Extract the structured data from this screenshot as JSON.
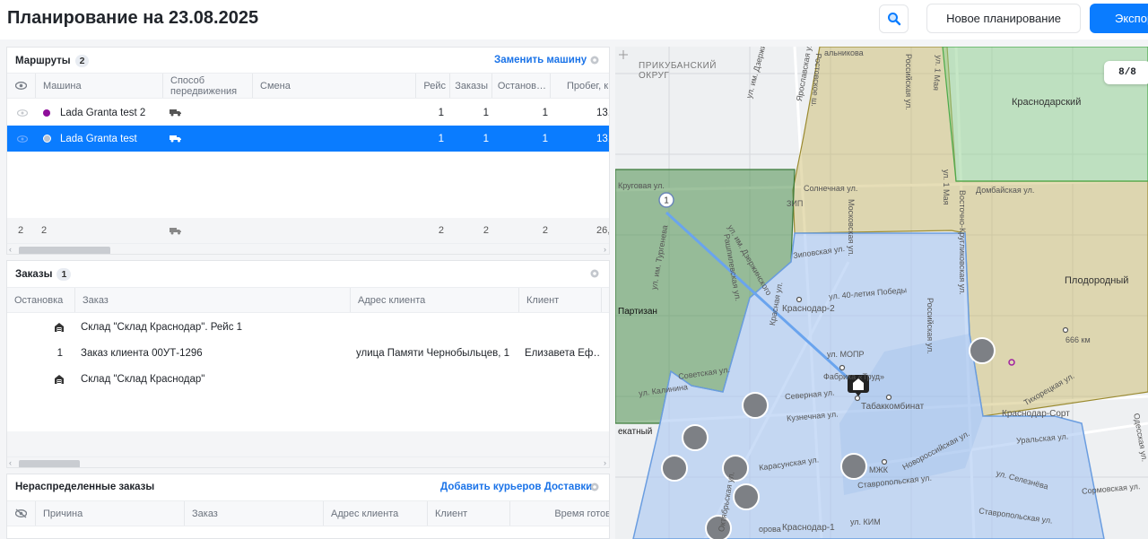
{
  "header": {
    "title": "Планирование на 23.08.2025",
    "new_planning_label": "Новое планирование",
    "export_label": "Экспор"
  },
  "routes": {
    "title": "Маршруты",
    "count": "2",
    "replace_car_label": "Заменить машину",
    "columns": [
      "Машина",
      "Способ передвижения",
      "Смена",
      "Рейс",
      "Заказы",
      "Останов…",
      "Пробег, к"
    ],
    "rows": [
      {
        "car": "Lada Granta test 2",
        "dot_color": "#8e0e9a",
        "trip": "1",
        "orders": "1",
        "stops": "1",
        "mileage": "13,",
        "selected": false
      },
      {
        "car": "Lada Granta test",
        "dot_color": "#b8c2d0",
        "trip": "1",
        "orders": "1",
        "stops": "1",
        "mileage": "13,",
        "selected": true
      }
    ],
    "totals": {
      "c1": "2",
      "c2": "2",
      "trip": "2",
      "orders": "2",
      "stops": "2",
      "mileage": "26,"
    }
  },
  "orders": {
    "title": "Заказы",
    "count": "1",
    "columns": [
      "Остановка",
      "Заказ",
      "Адрес клиента",
      "Клиент"
    ],
    "rows": [
      {
        "stop": "",
        "stop_icon": "warehouse-icon",
        "order": "Склад \"Склад Краснодар\". Рейс 1",
        "address": "",
        "client": ""
      },
      {
        "stop": "1",
        "stop_icon": "",
        "order": "Заказ клиента 00УТ-1296",
        "address": "улица Памяти Чернобыльцев, 1",
        "client": "Елизавета Еф…"
      },
      {
        "stop": "",
        "stop_icon": "warehouse-icon",
        "order": "Склад \"Склад Краснодар\"",
        "address": "",
        "client": ""
      }
    ]
  },
  "unassigned": {
    "title": "Нераспределенные заказы",
    "add_couriers_label": "Добавить курьеров Доставки",
    "columns": [
      "Причина",
      "Заказ",
      "Адрес клиента",
      "Клиент",
      "Время готов"
    ]
  },
  "map": {
    "route_counter": "8/8",
    "labels": {
      "prikubansky": "ПРИКУБАНСКИЙ\nОКРУГ",
      "krasnodarsky": "Краснодарский",
      "plodorodny": "Плодородный",
      "partizan": "Партизан",
      "krasnodar1": "Краснодар-1",
      "krasnodar2": "Краснодар-2",
      "krasnodar_sort": "Краснодар-Сорт",
      "tabakkombinat": "Табаккомбинат",
      "fabrika": "Фабрика «Труд»",
      "mzhk": "МЖК",
      "km666": "666 км",
      "zip": "ЗИП",
      "kalinina": "ул. Калинина",
      "sovetskaya": "Советская ул.",
      "severnaya": "Северная ул.",
      "severnaya2": "Северная ул.",
      "kuznechnaya": "Кузнечная ул.",
      "karasunskaya": "Карасунская ул.",
      "stavropolskaya": "Ставропольская ул.",
      "stavropolskaya2": "Ставропольская ул.",
      "uralskaya": "Уральская ул.",
      "selezneva": "ул. Селезнёва",
      "sormovskaya": "Сормовская ул.",
      "kim": "ул. КИМ",
      "novorossiyskaya": "Новороссийская ул.",
      "zipovskaya": "Зиповская ул.",
      "pobedy": "ул. 40-летия Победы",
      "dombayskaya": "Домбайская ул.",
      "solnechnaya": "Солнечная ул.",
      "krugovaya": "Круговая ул.",
      "turgeneva": "ул. им. Тургенева",
      "moskovskaya": "Московская ул.",
      "rossiyskaya": "Российская ул.",
      "rossiyskaya2": "Российская ул.",
      "rostovskoe": "Ростовское ш.",
      "yaroslavskaya": "Ярославская ул.",
      "dzerzhinskogo": "ул. им. Дзержинского",
      "dzerzhinskogo2": "ул. им. Дзержинского",
      "ul1maya": "ул. 1 Мая",
      "ul1maya2": "ул. 1 Мая",
      "vostochno": "Восточно-Кругликовская ул.",
      "tihoretskaya": "Тихорецкая ул.",
      "krasnaya": "Красная ул.",
      "oktyabrskaya": "Октябрьская ул.",
      "molpr": "ул. МОПР",
      "kalnikova": "альникова",
      "rashpilevskaya": "Рашпилевская ул.",
      "vorova": "орова",
      "ekatny": "екатный",
      "odeskaya": "Одесская ул.",
      "route_num": "1"
    }
  }
}
